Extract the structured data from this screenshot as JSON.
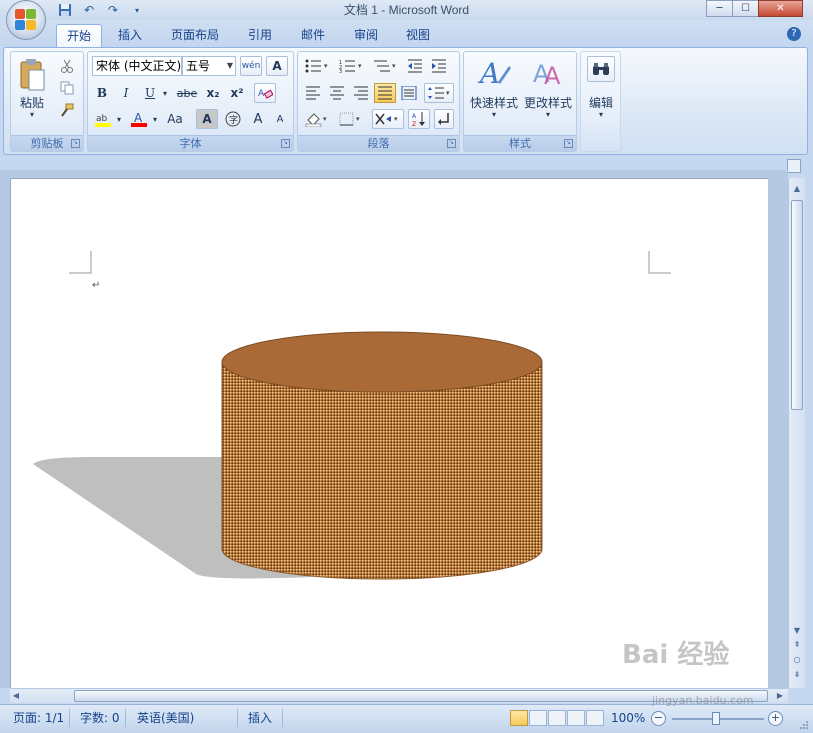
{
  "window": {
    "title": "文档 1 - Microsoft Word",
    "minimize": "─",
    "maximize": "☐",
    "close": "✕"
  },
  "quick_access": [
    "save-icon",
    "undo-icon",
    "redo-icon",
    "customize-icon"
  ],
  "tabs": [
    {
      "label": "开始",
      "active": true
    },
    {
      "label": "插入"
    },
    {
      "label": "页面布局"
    },
    {
      "label": "引用"
    },
    {
      "label": "邮件"
    },
    {
      "label": "审阅"
    },
    {
      "label": "视图"
    }
  ],
  "help": "?",
  "ribbon": {
    "clipboard": {
      "label": "剪贴板",
      "paste_label": "粘贴"
    },
    "font": {
      "label": "字体",
      "font_name": "宋体 (中文正文)",
      "font_size": "五号",
      "bold": "B",
      "italic": "I",
      "underline": "U",
      "strike": "abe",
      "subscript": "x₂",
      "superscript": "x²",
      "change_case": "Aa",
      "grow": "A",
      "shrink": "A"
    },
    "paragraph": {
      "label": "段落"
    },
    "styles": {
      "label": "样式",
      "quick_styles": "快速样式",
      "change_styles": "更改样式"
    },
    "editing": {
      "label": "编辑"
    }
  },
  "status": {
    "page": "页面: 1/1",
    "words": "字数: 0",
    "language": "英语(美国)",
    "mode": "插入",
    "zoom": "100%"
  },
  "watermark": {
    "text": "Bai 经验",
    "sub": "jingyan.baidu.com"
  },
  "colors": {
    "cylinder_top": "#a96a37",
    "cylinder_side": "#b5742f",
    "shadow": "#bfbfbf",
    "highlight_yellow": "#ffff00",
    "font_red": "#ff0000"
  }
}
